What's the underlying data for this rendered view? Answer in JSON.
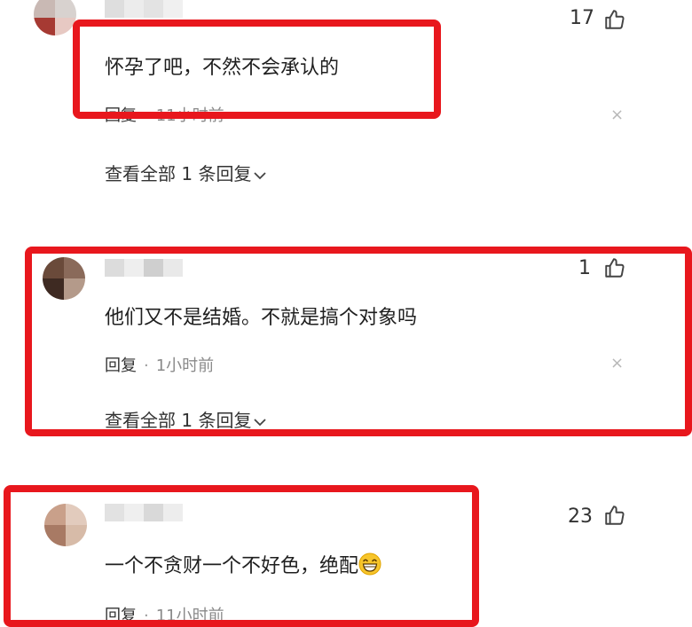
{
  "comments": [
    {
      "likes": "17",
      "text": "怀孕了吧，不然不会承认的",
      "reply_label": "回复",
      "time": "11小时前",
      "view_all": "查看全部 1 条回复"
    },
    {
      "likes": "1",
      "text": "他们又不是结婚。不就是搞个对象吗",
      "reply_label": "回复",
      "time": "1小时前",
      "view_all": "查看全部 1 条回复"
    },
    {
      "likes": "23",
      "text": "一个不贪财一个不好色，绝配",
      "reply_label": "回复",
      "time": "11小时前"
    }
  ],
  "separator_dot": "·",
  "close_glyph": "×",
  "icons": {
    "like": "thumbs-up-icon",
    "close": "close-icon",
    "expand": "chevron-down-icon",
    "emoji": "grinning-emoji-icon"
  },
  "colors": {
    "highlight": "#e8171d",
    "text": "#1f1f1f",
    "meta": "#8a8a8a"
  }
}
